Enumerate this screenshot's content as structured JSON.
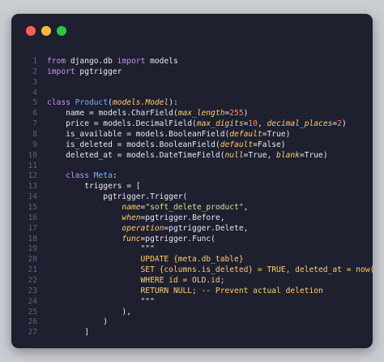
{
  "window": {
    "controls": [
      {
        "name": "close",
        "color": "#ff5f57"
      },
      {
        "name": "minimize",
        "color": "#febc2e"
      },
      {
        "name": "maximize",
        "color": "#28c840"
      }
    ]
  },
  "code": {
    "lines": [
      {
        "n": "1",
        "tokens": [
          {
            "t": "from",
            "c": "kw"
          },
          {
            "t": " django.db ",
            "c": "pl"
          },
          {
            "t": "import",
            "c": "kw"
          },
          {
            "t": " models",
            "c": "pl"
          }
        ]
      },
      {
        "n": "2",
        "tokens": [
          {
            "t": "import",
            "c": "kw"
          },
          {
            "t": " pgtrigger",
            "c": "pl"
          }
        ]
      },
      {
        "n": "3",
        "tokens": []
      },
      {
        "n": "4",
        "tokens": []
      },
      {
        "n": "5",
        "tokens": [
          {
            "t": "class",
            "c": "kw"
          },
          {
            "t": " ",
            "c": "pl"
          },
          {
            "t": "Product",
            "c": "fn"
          },
          {
            "t": "(",
            "c": "pl"
          },
          {
            "t": "models.Model",
            "c": "arg"
          },
          {
            "t": "):",
            "c": "pl"
          }
        ]
      },
      {
        "n": "6",
        "tokens": [
          {
            "t": "    name = models.CharField(",
            "c": "pl"
          },
          {
            "t": "max_length",
            "c": "kwarg"
          },
          {
            "t": "=",
            "c": "pl"
          },
          {
            "t": "255",
            "c": "num"
          },
          {
            "t": ")",
            "c": "pl"
          }
        ]
      },
      {
        "n": "7",
        "tokens": [
          {
            "t": "    price = models.DecimalField(",
            "c": "pl"
          },
          {
            "t": "max_digits",
            "c": "kwarg"
          },
          {
            "t": "=",
            "c": "pl"
          },
          {
            "t": "10",
            "c": "num"
          },
          {
            "t": ", ",
            "c": "pl"
          },
          {
            "t": "decimal_places",
            "c": "kwarg"
          },
          {
            "t": "=",
            "c": "pl"
          },
          {
            "t": "2",
            "c": "num"
          },
          {
            "t": ")",
            "c": "pl"
          }
        ]
      },
      {
        "n": "8",
        "tokens": [
          {
            "t": "    is_available = models.BooleanField(",
            "c": "pl"
          },
          {
            "t": "default",
            "c": "kwarg"
          },
          {
            "t": "=True)",
            "c": "pl"
          }
        ]
      },
      {
        "n": "9",
        "tokens": [
          {
            "t": "    is_deleted = models.BooleanField(",
            "c": "pl"
          },
          {
            "t": "default",
            "c": "kwarg"
          },
          {
            "t": "=False)",
            "c": "pl"
          }
        ]
      },
      {
        "n": "10",
        "tokens": [
          {
            "t": "    deleted_at = models.DateTimeField(",
            "c": "pl"
          },
          {
            "t": "null",
            "c": "kwarg"
          },
          {
            "t": "=True, ",
            "c": "pl"
          },
          {
            "t": "blank",
            "c": "kwarg"
          },
          {
            "t": "=True)",
            "c": "pl"
          }
        ]
      },
      {
        "n": "11",
        "tokens": []
      },
      {
        "n": "12",
        "tokens": [
          {
            "t": "    ",
            "c": "pl"
          },
          {
            "t": "class",
            "c": "kw"
          },
          {
            "t": " ",
            "c": "pl"
          },
          {
            "t": "Meta",
            "c": "fn"
          },
          {
            "t": ":",
            "c": "pl"
          }
        ]
      },
      {
        "n": "13",
        "tokens": [
          {
            "t": "        triggers = [",
            "c": "pl"
          }
        ]
      },
      {
        "n": "14",
        "tokens": [
          {
            "t": "            pgtrigger.Trigger(",
            "c": "pl"
          }
        ]
      },
      {
        "n": "15",
        "tokens": [
          {
            "t": "                ",
            "c": "pl"
          },
          {
            "t": "name",
            "c": "kwarg"
          },
          {
            "t": "=",
            "c": "pl"
          },
          {
            "t": "\"soft_delete_product\"",
            "c": "str"
          },
          {
            "t": ",",
            "c": "pl"
          }
        ]
      },
      {
        "n": "16",
        "tokens": [
          {
            "t": "                ",
            "c": "pl"
          },
          {
            "t": "when",
            "c": "kwarg"
          },
          {
            "t": "=pgtrigger.Before,",
            "c": "pl"
          }
        ]
      },
      {
        "n": "17",
        "tokens": [
          {
            "t": "                ",
            "c": "pl"
          },
          {
            "t": "operation",
            "c": "kwarg"
          },
          {
            "t": "=pgtrigger.Delete,",
            "c": "pl"
          }
        ]
      },
      {
        "n": "18",
        "tokens": [
          {
            "t": "                ",
            "c": "pl"
          },
          {
            "t": "func",
            "c": "kwarg"
          },
          {
            "t": "=pgtrigger.Func(",
            "c": "pl"
          }
        ]
      },
      {
        "n": "19",
        "tokens": [
          {
            "t": "                    \"\"\"",
            "c": "pl"
          }
        ]
      },
      {
        "n": "20",
        "tokens": [
          {
            "t": "                    UPDATE {meta.db_table}",
            "c": "sql"
          }
        ]
      },
      {
        "n": "21",
        "tokens": [
          {
            "t": "                    SET {columns.is_deleted} = TRUE, deleted_at = now()",
            "c": "sql"
          }
        ]
      },
      {
        "n": "22",
        "tokens": [
          {
            "t": "                    WHERE id = OLD.id;",
            "c": "sql"
          }
        ]
      },
      {
        "n": "23",
        "tokens": [
          {
            "t": "                    RETURN NULL; -- Prevent actual deletion",
            "c": "sql"
          }
        ]
      },
      {
        "n": "24",
        "tokens": [
          {
            "t": "                    \"\"\"",
            "c": "pl"
          }
        ]
      },
      {
        "n": "25",
        "tokens": [
          {
            "t": "                ),",
            "c": "pl"
          }
        ]
      },
      {
        "n": "26",
        "tokens": [
          {
            "t": "            )",
            "c": "pl"
          }
        ]
      },
      {
        "n": "27",
        "tokens": [
          {
            "t": "        ]",
            "c": "pl"
          }
        ]
      }
    ]
  }
}
